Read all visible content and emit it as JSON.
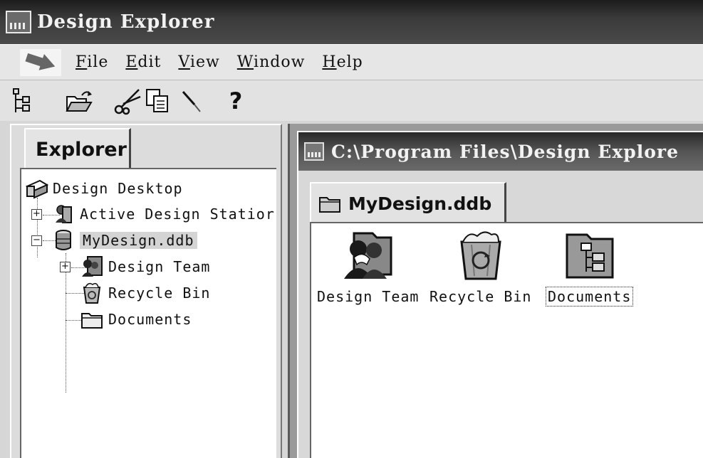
{
  "window": {
    "title": "Design Explorer"
  },
  "menu": {
    "items": [
      {
        "label": "File"
      },
      {
        "label": "Edit"
      },
      {
        "label": "View"
      },
      {
        "label": "Window"
      },
      {
        "label": "Help"
      }
    ]
  },
  "toolbar": {
    "buttons": [
      {
        "icon": "tree-view-icon"
      },
      {
        "icon": "open-folder-icon"
      },
      {
        "icon": "cut-icon"
      },
      {
        "icon": "copy-icon"
      },
      {
        "icon": "paste-icon"
      },
      {
        "icon": "help-icon",
        "label": "?"
      }
    ]
  },
  "explorer": {
    "tab_label": "Explorer",
    "tree": [
      {
        "label": "Design Desktop",
        "icon": "desktop-icon"
      },
      {
        "label": "Active Design Statior",
        "icon": "station-icon",
        "expander": "+"
      },
      {
        "label": "MyDesign.ddb",
        "icon": "database-icon",
        "expander": "−",
        "selected": true
      },
      {
        "label": "Design Team",
        "icon": "team-icon",
        "expander": "+"
      },
      {
        "label": "Recycle Bin",
        "icon": "recycle-bin-icon"
      },
      {
        "label": "Documents",
        "icon": "folder-icon"
      }
    ]
  },
  "document": {
    "title": "C:\\Program Files\\Design Explore",
    "tab_label": "MyDesign.ddb",
    "items": [
      {
        "label": "Design Team",
        "icon": "team-icon"
      },
      {
        "label": "Recycle Bin",
        "icon": "recycle-bin-icon"
      },
      {
        "label": "Documents",
        "icon": "documents-folder-icon",
        "focused": true
      }
    ]
  }
}
